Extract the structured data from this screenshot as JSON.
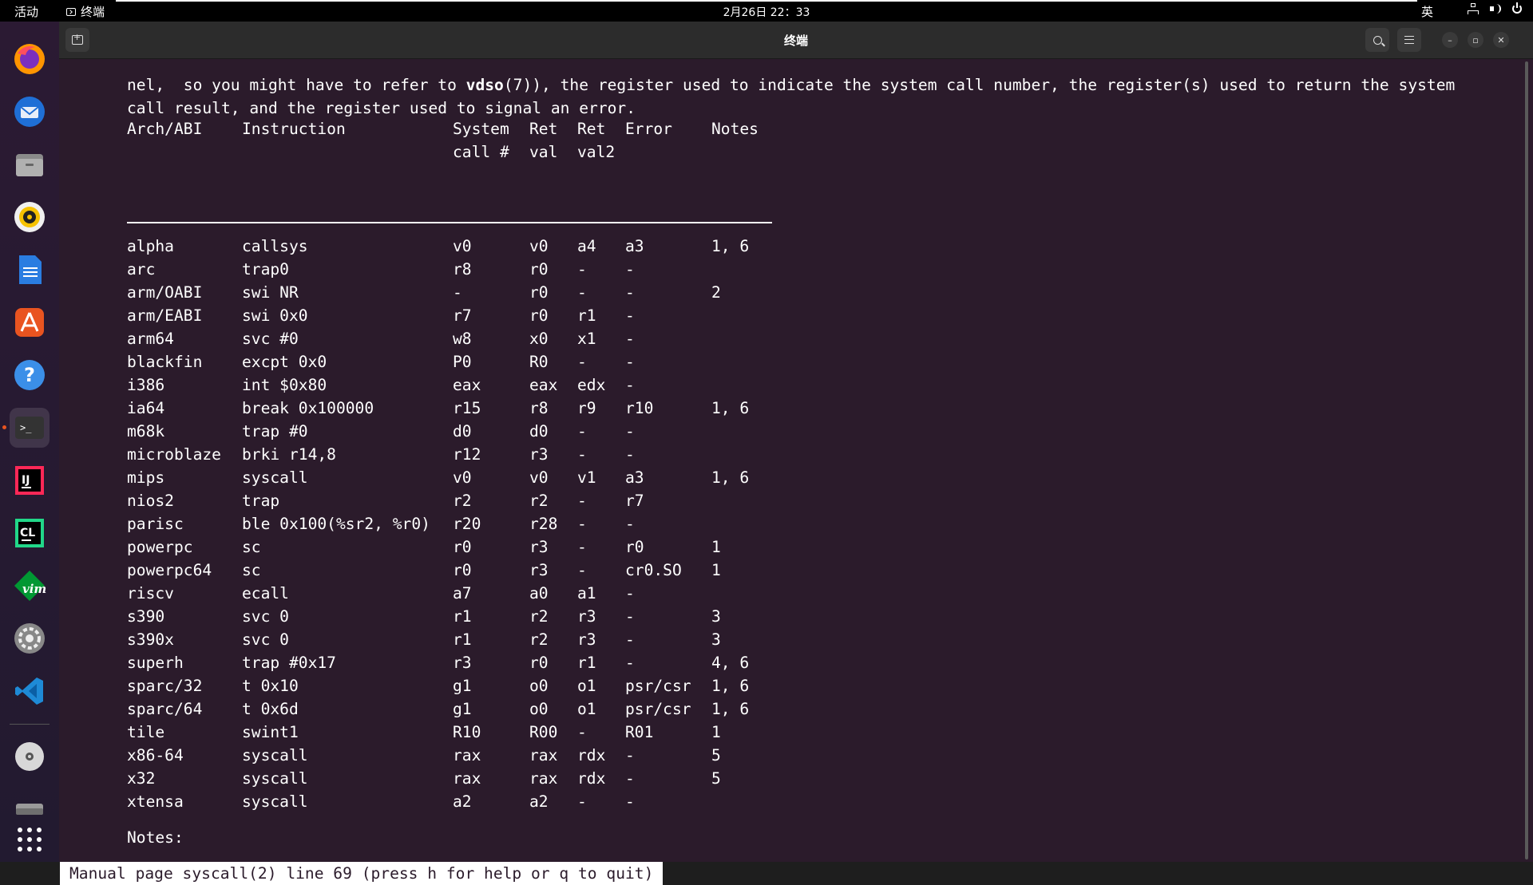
{
  "topbar": {
    "activities": "活动",
    "app_name": "终端",
    "clock": "2月26日 22：33",
    "ime": "英"
  },
  "dock": {
    "items": [
      {
        "name": "firefox-icon"
      },
      {
        "name": "thunderbird-icon"
      },
      {
        "name": "files-icon"
      },
      {
        "name": "rhythmbox-icon"
      },
      {
        "name": "writer-icon"
      },
      {
        "name": "app-center-icon"
      },
      {
        "name": "help-icon"
      },
      {
        "name": "terminal-icon"
      },
      {
        "name": "intellij-icon"
      },
      {
        "name": "clion-icon"
      },
      {
        "name": "vim-icon"
      },
      {
        "name": "settings-icon"
      },
      {
        "name": "vscode-icon"
      },
      {
        "name": "disc-icon"
      },
      {
        "name": "drive-icon"
      },
      {
        "name": "show-apps-icon"
      }
    ]
  },
  "window": {
    "title": "终端",
    "min_label": "–",
    "max_label": "▫",
    "close_label": "✕"
  },
  "terminal": {
    "intro_line1": "nel,  so you might have to refer to ",
    "intro_bold": "vdso",
    "intro_line1_rest": "(7)), the register used to indicate the system call number, the register(s) used to return the system",
    "intro_line2": "call result, and the register used to signal an error.",
    "header_row1": [
      "Arch/ABI",
      "Instruction",
      "System",
      "Ret",
      "Ret",
      "Error",
      "Notes"
    ],
    "header_row2": [
      "",
      "",
      "call #",
      "val",
      "val2",
      "",
      ""
    ],
    "rows": [
      [
        "alpha",
        "callsys",
        "v0",
        "v0",
        "a4",
        "a3",
        "1, 6"
      ],
      [
        "arc",
        "trap0",
        "r8",
        "r0",
        "-",
        "-",
        ""
      ],
      [
        "arm/OABI",
        "swi NR",
        "-",
        "r0",
        "-",
        "-",
        "2"
      ],
      [
        "arm/EABI",
        "swi 0x0",
        "r7",
        "r0",
        "r1",
        "-",
        ""
      ],
      [
        "arm64",
        "svc #0",
        "w8",
        "x0",
        "x1",
        "-",
        ""
      ],
      [
        "blackfin",
        "excpt 0x0",
        "P0",
        "R0",
        "-",
        "-",
        ""
      ],
      [
        "i386",
        "int $0x80",
        "eax",
        "eax",
        "edx",
        "-",
        ""
      ],
      [
        "ia64",
        "break 0x100000",
        "r15",
        "r8",
        "r9",
        "r10",
        "1, 6"
      ],
      [
        "m68k",
        "trap #0",
        "d0",
        "d0",
        "-",
        "-",
        ""
      ],
      [
        "microblaze",
        "brki r14,8",
        "r12",
        "r3",
        "-",
        "-",
        ""
      ],
      [
        "mips",
        "syscall",
        "v0",
        "v0",
        "v1",
        "a3",
        "1, 6"
      ],
      [
        "nios2",
        "trap",
        "r2",
        "r2",
        "-",
        "r7",
        ""
      ],
      [
        "parisc",
        "ble 0x100(%sr2, %r0)",
        "r20",
        "r28",
        "-",
        "-",
        ""
      ],
      [
        "powerpc",
        "sc",
        "r0",
        "r3",
        "-",
        "r0",
        "1"
      ],
      [
        "powerpc64",
        "sc",
        "r0",
        "r3",
        "-",
        "cr0.SO",
        "1"
      ],
      [
        "riscv",
        "ecall",
        "a7",
        "a0",
        "a1",
        "-",
        ""
      ],
      [
        "s390",
        "svc 0",
        "r1",
        "r2",
        "r3",
        "-",
        "3"
      ],
      [
        "s390x",
        "svc 0",
        "r1",
        "r2",
        "r3",
        "-",
        "3"
      ],
      [
        "superh",
        "trap #0x17",
        "r3",
        "r0",
        "r1",
        "-",
        "4, 6"
      ],
      [
        "sparc/32",
        "t 0x10",
        "g1",
        "o0",
        "o1",
        "psr/csr",
        "1, 6"
      ],
      [
        "sparc/64",
        "t 0x6d",
        "g1",
        "o0",
        "o1",
        "psr/csr",
        "1, 6"
      ],
      [
        "tile",
        "swint1",
        "R10",
        "R00",
        "-",
        "R01",
        "1"
      ],
      [
        "x86-64",
        "syscall",
        "rax",
        "rax",
        "rdx",
        "-",
        "5"
      ],
      [
        "x32",
        "syscall",
        "rax",
        "rax",
        "rdx",
        "-",
        "5"
      ],
      [
        "xtensa",
        "syscall",
        "a2",
        "a2",
        "-",
        "-",
        ""
      ]
    ],
    "notes_heading": "Notes:",
    "status_line": "Manual page syscall(2) line 69 (press h for help or q to quit)"
  }
}
